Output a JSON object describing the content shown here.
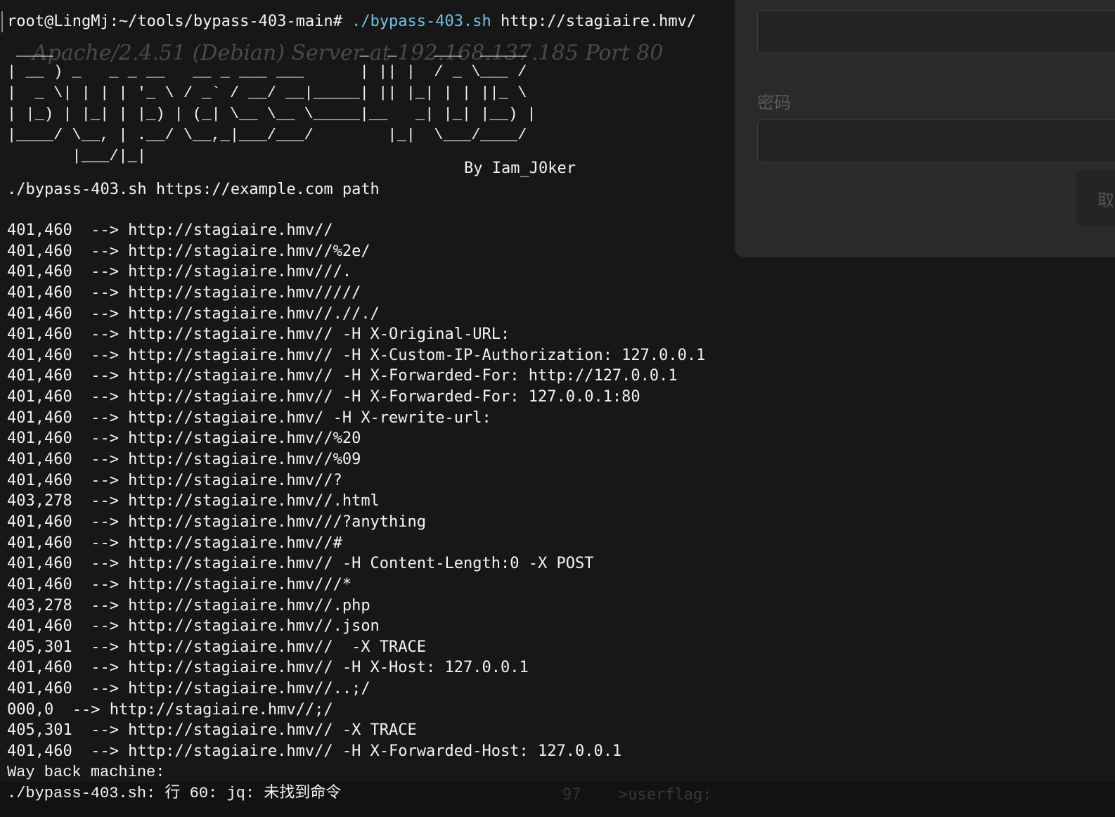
{
  "dialog": {
    "password_label": "密码",
    "button_text": "取"
  },
  "ghost_text": "Apache/2.4.51 (Debian) Server at 192.168.137.185 Port 80",
  "terminal": {
    "prompt": "root@LingMj:~/tools/bypass-403-main#",
    "command": "./bypass-403.sh",
    "argument": "http://stagiaire.hmv/",
    "banner": " ____                                 _  _    ___  _____ \n| __ ) _   _ _ __   __ _ ___ ___      | || |  / _ \\___ / \n|  _ \\| | | | '_ \\ / _` / __/ __|_____| || |_| | | ||_ \\ \n| |_) | |_| | |_) | (_| \\__ \\__ \\_____|__   _| |_| |__) |\n|____/ \\__, | .__/ \\__,_|___/___/        |_|  \\___/____/ \n       |___/|_|",
    "author": "By Iam_J0ker",
    "usage": "./bypass-403.sh https://example.com path",
    "results": [
      "401,460  --> http://stagiaire.hmv//",
      "401,460  --> http://stagiaire.hmv//%2e/",
      "401,460  --> http://stagiaire.hmv///.",
      "401,460  --> http://stagiaire.hmv/////",
      "401,460  --> http://stagiaire.hmv//.//./",
      "401,460  --> http://stagiaire.hmv// -H X-Original-URL:",
      "401,460  --> http://stagiaire.hmv// -H X-Custom-IP-Authorization: 127.0.0.1",
      "401,460  --> http://stagiaire.hmv// -H X-Forwarded-For: http://127.0.0.1",
      "401,460  --> http://stagiaire.hmv// -H X-Forwarded-For: 127.0.0.1:80",
      "401,460  --> http://stagiaire.hmv/ -H X-rewrite-url:",
      "401,460  --> http://stagiaire.hmv//%20",
      "401,460  --> http://stagiaire.hmv//%09",
      "401,460  --> http://stagiaire.hmv//?",
      "403,278  --> http://stagiaire.hmv//.html",
      "401,460  --> http://stagiaire.hmv///?anything",
      "401,460  --> http://stagiaire.hmv//#",
      "401,460  --> http://stagiaire.hmv// -H Content-Length:0 -X POST",
      "401,460  --> http://stagiaire.hmv///*",
      "403,278  --> http://stagiaire.hmv//.php",
      "401,460  --> http://stagiaire.hmv//.json",
      "405,301  --> http://stagiaire.hmv//  -X TRACE",
      "401,460  --> http://stagiaire.hmv// -H X-Host: 127.0.0.1",
      "401,460  --> http://stagiaire.hmv//..;/",
      "000,0  --> http://stagiaire.hmv//;/",
      "405,301  --> http://stagiaire.hmv// -X TRACE",
      "401,460  --> http://stagiaire.hmv// -H X-Forwarded-Host: 127.0.0.1"
    ],
    "wayback": "Way back machine:",
    "error": "./bypass-403.sh: 行 60: jq: 未找到命令"
  },
  "background": {
    "line_number": "97",
    "userflag": ">userflag:"
  }
}
